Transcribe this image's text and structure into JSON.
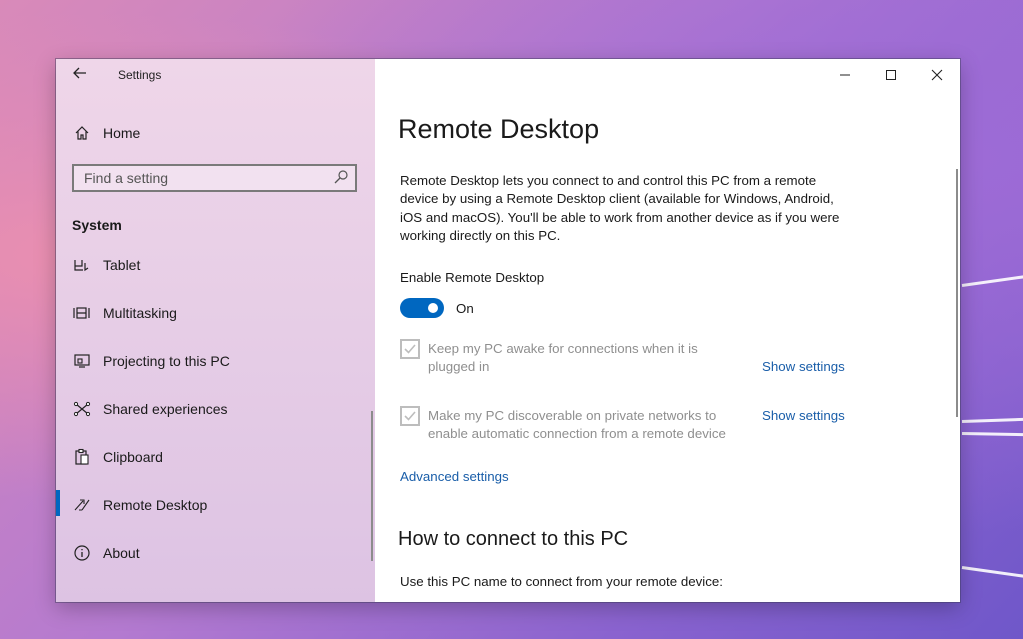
{
  "window": {
    "title": "Settings",
    "controls": {
      "minimize": "minimize-icon",
      "maximize": "maximize-icon",
      "close": "close-icon"
    }
  },
  "sidebar": {
    "home_label": "Home",
    "search_placeholder": "Find a setting",
    "section_title": "System",
    "items": [
      {
        "label": "Tablet",
        "icon": "tablet-icon",
        "active": false
      },
      {
        "label": "Multitasking",
        "icon": "multitasking-icon",
        "active": false
      },
      {
        "label": "Projecting to this PC",
        "icon": "projecting-icon",
        "active": false
      },
      {
        "label": "Shared experiences",
        "icon": "shared-experiences-icon",
        "active": false
      },
      {
        "label": "Clipboard",
        "icon": "clipboard-icon",
        "active": false
      },
      {
        "label": "Remote Desktop",
        "icon": "remote-desktop-icon",
        "active": true
      },
      {
        "label": "About",
        "icon": "info-icon",
        "active": false
      }
    ]
  },
  "main": {
    "title": "Remote Desktop",
    "description": "Remote Desktop lets you connect to and control this PC from a remote device by using a Remote Desktop client (available for Windows, Android, iOS and macOS). You'll be able to work from another device as if you were working directly on this PC.",
    "enable_label": "Enable Remote Desktop",
    "toggle_state": "On",
    "toggle_on": true,
    "options": [
      {
        "label": "Keep my PC awake for connections when it is plugged in",
        "checked": true,
        "link": "Show settings"
      },
      {
        "label": "Make my PC discoverable on private networks to enable automatic connection from a remote device",
        "checked": true,
        "link": "Show settings"
      }
    ],
    "advanced_link": "Advanced settings",
    "how_to_title": "How to connect to this PC",
    "use_name_text": "Use this PC name to connect from your remote device:"
  },
  "colors": {
    "accent": "#0067c0",
    "link": "#1a5ea9",
    "disabled_text": "#8f8f8f"
  }
}
